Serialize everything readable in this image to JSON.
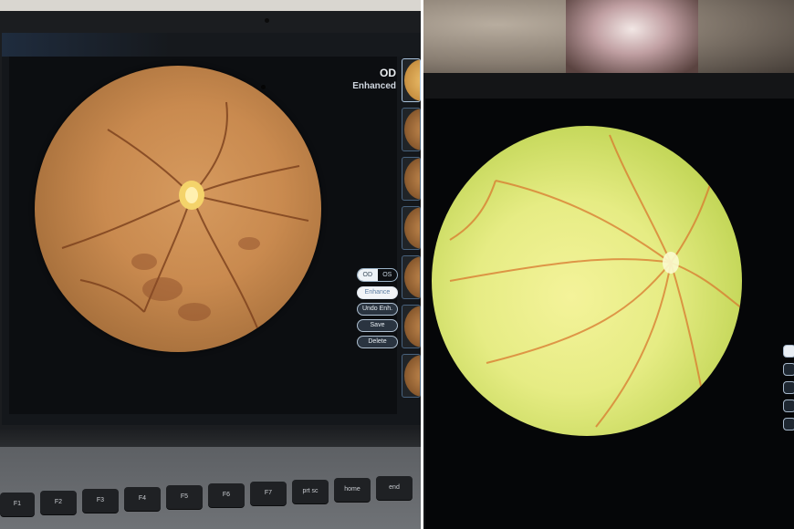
{
  "left_app": {
    "eye": "OD",
    "mode": "Enhanced",
    "eye_toggle": [
      "OD",
      "OS"
    ],
    "buttons": {
      "enhance": "Enhance",
      "undo_enh": "Undo Enh.",
      "save": "Save",
      "delete": "Delete"
    },
    "thumbnail_count": 7
  },
  "keyboard": {
    "keys": [
      "F1",
      "F2",
      "F3",
      "F4",
      "F5",
      "F6",
      "F7",
      "F8",
      "F9",
      "prt sc",
      "home",
      "end"
    ],
    "sublabels": [
      "",
      "",
      "",
      "",
      "",
      "",
      "",
      "",
      "",
      "F10",
      "F11",
      ""
    ]
  },
  "colors": {
    "fundus_left": "#c98a4f",
    "fundus_right": "#e6ec84",
    "vessels_left": "#7a3f1c",
    "vessels_right": "#d9782f",
    "screen_bg": "#0c0e11"
  }
}
